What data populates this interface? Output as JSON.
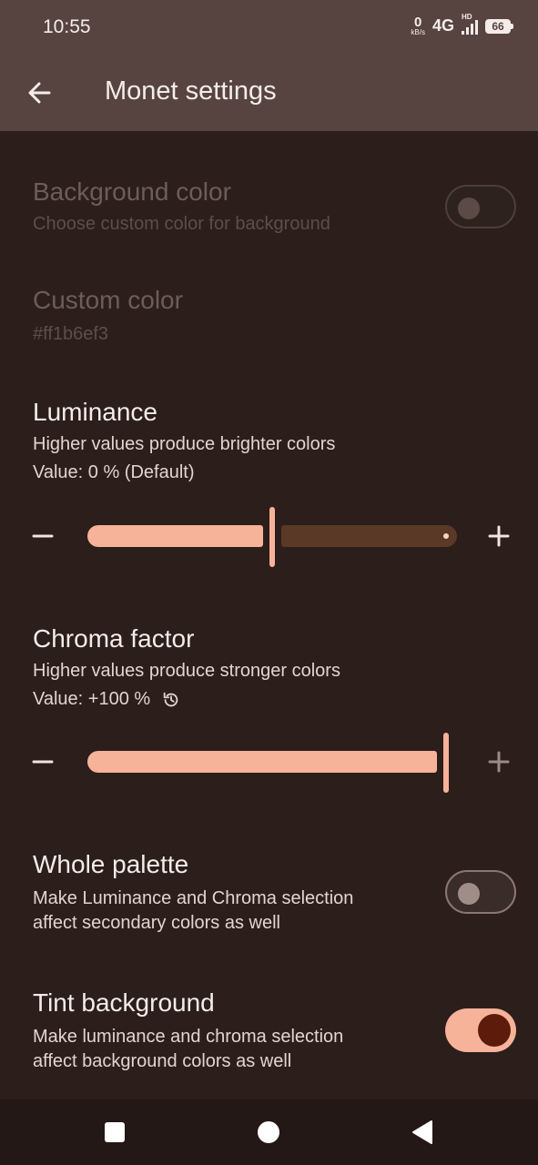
{
  "status_bar": {
    "time": "10:55",
    "net_speed_value": "0",
    "net_speed_unit": "kB/s",
    "network_type": "4G",
    "hd_label": "HD",
    "battery": "66"
  },
  "app_bar": {
    "title": "Monet settings",
    "back_icon": "arrow-left-icon"
  },
  "settings": {
    "background_color": {
      "title": "Background color",
      "description": "Choose custom color for background",
      "enabled": false,
      "toggle_on": false
    },
    "custom_color": {
      "title": "Custom color",
      "value": "#ff1b6ef3",
      "enabled": false
    },
    "luminance": {
      "title": "Luminance",
      "description": "Higher values produce brighter colors",
      "value_text": "Value: 0 % (Default)",
      "slider_fraction": 0.5
    },
    "chroma_factor": {
      "title": "Chroma factor",
      "description": "Higher values produce stronger colors",
      "value_text": "Value: +100 %",
      "reset_icon": "reset-icon",
      "slider_fraction": 1.0
    },
    "whole_palette": {
      "title": "Whole palette",
      "description_line1": "Make Luminance and Chroma selection",
      "description_line2": "affect secondary colors as well",
      "toggle_on": false
    },
    "tint_background": {
      "title": "Tint background",
      "description_line1": "Make luminance and chroma selection",
      "description_line2": "affect background colors as well",
      "toggle_on": true
    }
  },
  "colors": {
    "accent": "#f7b29a",
    "background": "#2b1e1b",
    "app_bar": "#574440",
    "track_inactive": "#5a3a26",
    "toggle_knob_on": "#5d1b0c"
  },
  "nav_bar": {
    "recents_icon": "square-icon",
    "home_icon": "circle-icon",
    "back_icon": "triangle-back-icon"
  }
}
